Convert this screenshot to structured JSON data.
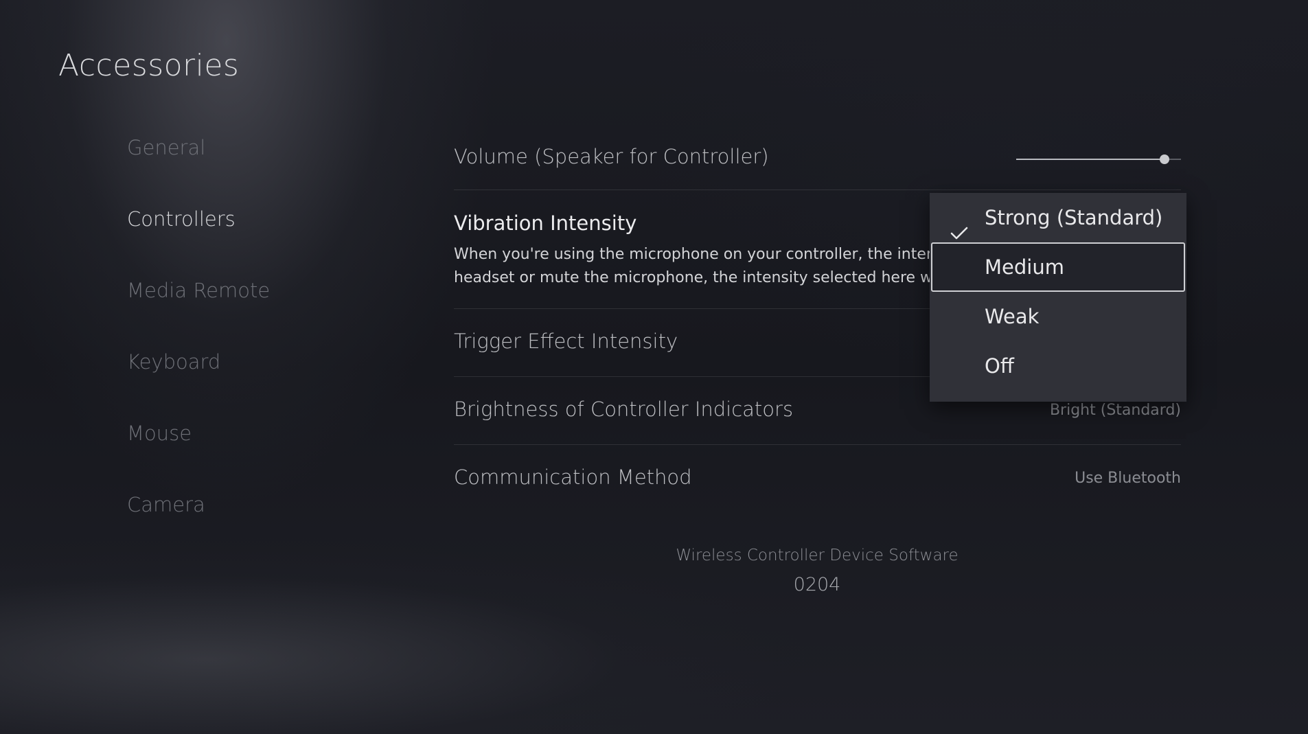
{
  "page": {
    "title": "Accessories"
  },
  "sidebar": {
    "items": [
      {
        "label": "General",
        "active": false
      },
      {
        "label": "Controllers",
        "active": true
      },
      {
        "label": "Media Remote",
        "active": false
      },
      {
        "label": "Keyboard",
        "active": false
      },
      {
        "label": "Mouse",
        "active": false
      },
      {
        "label": "Camera",
        "active": false
      }
    ]
  },
  "settings": {
    "volume": {
      "label": "Volume (Speaker for Controller)",
      "level": 0.9
    },
    "vibration": {
      "label": "Vibration Intensity",
      "description_line1": "When you're using the microphone on your controller, the intens",
      "description_line2": "headset or mute the microphone, the intensity selected here wil"
    },
    "trigger": {
      "label": "Trigger Effect Intensity"
    },
    "brightness": {
      "label": "Brightness of Controller Indicators",
      "value": "Bright (Standard)"
    },
    "communication": {
      "label": "Communication Method",
      "value": "Use Bluetooth"
    }
  },
  "software": {
    "label": "Wireless Controller Device Software",
    "version": "0204"
  },
  "dropdown": {
    "options": [
      {
        "label": "Strong (Standard)",
        "selected": true,
        "focused": false
      },
      {
        "label": "Medium",
        "selected": false,
        "focused": true
      },
      {
        "label": "Weak",
        "selected": false,
        "focused": false
      },
      {
        "label": "Off",
        "selected": false,
        "focused": false
      }
    ],
    "check_icon": "checkmark-icon"
  },
  "colors": {
    "background": "#17181e",
    "dropdown_bg": "#303138",
    "active_text": "#d7d8db",
    "inactive_text": "#6f7178"
  }
}
